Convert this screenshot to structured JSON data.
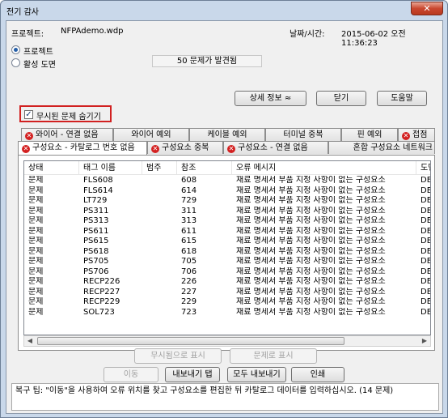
{
  "window": {
    "title": "전기 감사",
    "close_glyph": "✕"
  },
  "info": {
    "project_label": "프로젝트:",
    "project_value": "NFPAdemo.wdp",
    "datetime_label": "날짜/시간:",
    "datetime_value": "2015-06-02  오전 11:36:23"
  },
  "scope": {
    "project": "프로젝트",
    "active_drawing": "활성 도면"
  },
  "problem_count": "50 문제가 발견됨",
  "buttons": {
    "details": "상세 정보  ≈",
    "close": "닫기",
    "help": "도움말",
    "show_as_ignored": "무시됨으로 표시",
    "show_as_problem": "문제로 표시",
    "move": "이동",
    "export_tab": "내보내기 탭",
    "export_all": "모두 내보내기",
    "print": "인쇄"
  },
  "hide_ignored": {
    "label": "무시된 문제 숨기기",
    "checked": true
  },
  "tabs_back": [
    {
      "label": "와이어 - 연결 없음",
      "error": true
    },
    {
      "label": "와이어 예외",
      "error": false
    },
    {
      "label": "케이블 예외",
      "error": false
    },
    {
      "label": "터미널 중복",
      "error": false
    },
    {
      "label": "핀 예외",
      "error": false
    },
    {
      "label": "접점",
      "error": true
    }
  ],
  "tabs_front": [
    {
      "label": "구성요소 - 카탈로그 번호 없음",
      "error": true,
      "active": true
    },
    {
      "label": "구성요소 중복",
      "error": true,
      "active": false
    },
    {
      "label": "구성요소 - 연결 없음",
      "error": true,
      "active": false
    },
    {
      "label": "혼합 구성요소 네트워크",
      "error": false,
      "active": false
    }
  ],
  "table": {
    "columns": [
      "상태",
      "태그 이름",
      "범주",
      "참조",
      "오류 메시지",
      "도면"
    ],
    "rows": [
      [
        "문제",
        "FLS608",
        "",
        "608",
        "재료 명세서 부품 지정 사항이 없는 구성요소",
        "DE"
      ],
      [
        "문제",
        "FLS614",
        "",
        "614",
        "재료 명세서 부품 지정 사항이 없는 구성요소",
        "DE"
      ],
      [
        "문제",
        "LT729",
        "",
        "729",
        "재료 명세서 부품 지정 사항이 없는 구성요소",
        "DE"
      ],
      [
        "문제",
        "PS311",
        "",
        "311",
        "재료 명세서 부품 지정 사항이 없는 구성요소",
        "DE"
      ],
      [
        "문제",
        "PS313",
        "",
        "313",
        "재료 명세서 부품 지정 사항이 없는 구성요소",
        "DE"
      ],
      [
        "문제",
        "PS611",
        "",
        "611",
        "재료 명세서 부품 지정 사항이 없는 구성요소",
        "DE"
      ],
      [
        "문제",
        "PS615",
        "",
        "615",
        "재료 명세서 부품 지정 사항이 없는 구성요소",
        "DE"
      ],
      [
        "문제",
        "PS618",
        "",
        "618",
        "재료 명세서 부품 지정 사항이 없는 구성요소",
        "DE"
      ],
      [
        "문제",
        "PS705",
        "",
        "705",
        "재료 명세서 부품 지정 사항이 없는 구성요소",
        "DE"
      ],
      [
        "문제",
        "PS706",
        "",
        "706",
        "재료 명세서 부품 지정 사항이 없는 구성요소",
        "DE"
      ],
      [
        "문제",
        "RECP226",
        "",
        "226",
        "재료 명세서 부품 지정 사항이 없는 구성요소",
        "DE"
      ],
      [
        "문제",
        "RECP227",
        "",
        "227",
        "재료 명세서 부품 지정 사항이 없는 구성요소",
        "DE"
      ],
      [
        "문제",
        "RECP229",
        "",
        "229",
        "재료 명세서 부품 지정 사항이 없는 구성요소",
        "DE"
      ],
      [
        "문제",
        "SOL723",
        "",
        "723",
        "재료 명세서 부품 지정 사항이 없는 구성요소",
        "DE"
      ]
    ]
  },
  "status_tip": "복구 팁: \"이동\"을 사용하여 오류 위치를 찾고 구성요소를 편집한 뒤 카탈로그 데이터를 입력하십시오. (14 문제)"
}
